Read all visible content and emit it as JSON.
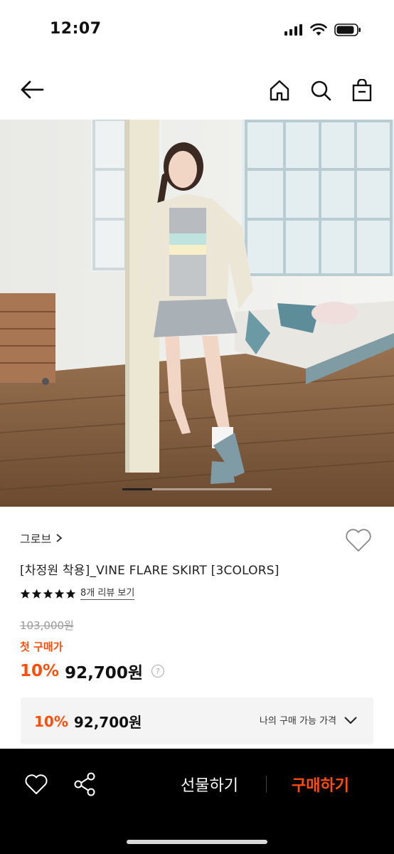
{
  "status": {
    "time": "12:07"
  },
  "product": {
    "brand": "그로브",
    "title": "[차정원 착용]_VINE FLARE SKIRT [3COLORS]",
    "rating_stars": 5,
    "review_link": "8개 리뷰 보기",
    "original_price": "103,000원",
    "first_purchase_label": "첫 구매가",
    "discount": "10%",
    "sale_price": "92,700원",
    "image_progress": 0.2
  },
  "my_price": {
    "discount": "10%",
    "price": "92,700원",
    "label": "나의 구매 가능 가격"
  },
  "bottom": {
    "gift_label": "선물하기",
    "buy_label": "구매하기"
  },
  "colors": {
    "accent": "#ff4e0a",
    "bar": "#000000"
  },
  "icons": [
    "back-arrow-icon",
    "home-icon",
    "search-icon",
    "shopping-bag-icon",
    "heart-icon",
    "share-icon",
    "chevron-down-icon",
    "info-icon",
    "star-icon"
  ]
}
